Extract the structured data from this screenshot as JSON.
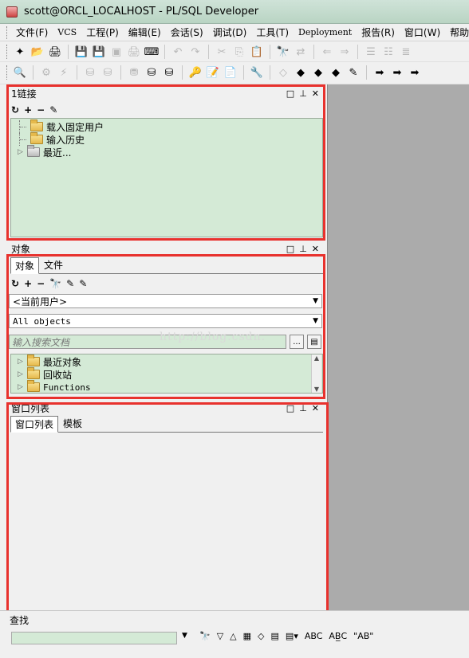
{
  "window": {
    "title": "scott@ORCL_LOCALHOST - PL/SQL Developer"
  },
  "menu": [
    {
      "label": "文件(F)",
      "latin": false
    },
    {
      "label": "VCS",
      "latin": true
    },
    {
      "label": "工程(P)",
      "latin": false
    },
    {
      "label": "编辑(E)",
      "latin": false
    },
    {
      "label": "会话(S)",
      "latin": false
    },
    {
      "label": "调试(D)",
      "latin": false
    },
    {
      "label": "工具(T)",
      "latin": false
    },
    {
      "label": "Deployment",
      "latin": true
    },
    {
      "label": "报告(R)",
      "latin": false
    },
    {
      "label": "窗口(W)",
      "latin": false
    },
    {
      "label": "帮助",
      "latin": false
    }
  ],
  "toolbar1": [
    {
      "glyph": "✦",
      "name": "new-icon",
      "disabled": false
    },
    {
      "glyph": "📂",
      "name": "open-folder-icon",
      "disabled": false
    },
    {
      "glyph": "🖨",
      "name": "print-setup-icon",
      "disabled": false
    },
    {
      "sep": true
    },
    {
      "glyph": "💾",
      "name": "save-icon",
      "disabled": true
    },
    {
      "glyph": "💾",
      "name": "save-as-icon",
      "disabled": true
    },
    {
      "glyph": "▣",
      "name": "save-all-icon",
      "disabled": true
    },
    {
      "glyph": "🖨",
      "name": "print-icon",
      "disabled": true
    },
    {
      "glyph": "⌨",
      "name": "keyboard-icon",
      "disabled": false
    },
    {
      "sep": true
    },
    {
      "glyph": "↶",
      "name": "undo-icon",
      "disabled": true
    },
    {
      "glyph": "↷",
      "name": "redo-icon",
      "disabled": true
    },
    {
      "sep": true
    },
    {
      "glyph": "✂",
      "name": "cut-icon",
      "disabled": true
    },
    {
      "glyph": "⎘",
      "name": "copy-icon",
      "disabled": true
    },
    {
      "glyph": "📋",
      "name": "paste-icon",
      "disabled": false
    },
    {
      "sep": true
    },
    {
      "glyph": "🔭",
      "name": "find-icon",
      "disabled": false
    },
    {
      "glyph": "⇄",
      "name": "replace-icon",
      "disabled": true
    },
    {
      "sep": true
    },
    {
      "glyph": "⇐",
      "name": "navigate-back-icon",
      "disabled": true
    },
    {
      "glyph": "⇒",
      "name": "navigate-forward-icon",
      "disabled": true
    },
    {
      "sep": true
    },
    {
      "glyph": "☰",
      "name": "indent-icon",
      "disabled": true
    },
    {
      "glyph": "☷",
      "name": "unindent-icon",
      "disabled": true
    },
    {
      "glyph": "≣",
      "name": "comment-icon",
      "disabled": true
    }
  ],
  "toolbar2": [
    {
      "glyph": "🔍",
      "name": "query-icon",
      "disabled": false
    },
    {
      "sep": true
    },
    {
      "glyph": "⚙",
      "name": "execute-icon",
      "disabled": true
    },
    {
      "glyph": "⚡",
      "name": "break-icon",
      "disabled": true
    },
    {
      "sep": true
    },
    {
      "glyph": "⛁",
      "name": "commit-icon",
      "disabled": true
    },
    {
      "glyph": "⛁",
      "name": "rollback-icon",
      "disabled": true
    },
    {
      "sep": true
    },
    {
      "glyph": "⛃",
      "name": "sql-window-icon",
      "disabled": true
    },
    {
      "glyph": "⛁",
      "name": "command-window-icon",
      "disabled": false
    },
    {
      "glyph": "⛁",
      "name": "test-window-icon",
      "disabled": false
    },
    {
      "sep": true
    },
    {
      "glyph": "🔑",
      "name": "login-icon",
      "disabled": false
    },
    {
      "glyph": "📝",
      "name": "report-icon",
      "disabled": false
    },
    {
      "glyph": "📄",
      "name": "explain-plan-icon",
      "disabled": false
    },
    {
      "sep": true
    },
    {
      "glyph": "🔧",
      "name": "tools-icon",
      "disabled": false
    },
    {
      "sep": true
    },
    {
      "glyph": "◇",
      "name": "eraser-icon",
      "disabled": true
    },
    {
      "glyph": "◆",
      "name": "bookmark-icon",
      "disabled": false
    },
    {
      "glyph": "◆",
      "name": "bookmark-prev-icon",
      "disabled": false
    },
    {
      "glyph": "◆",
      "name": "bookmark-next-icon",
      "disabled": false
    },
    {
      "glyph": "✎",
      "name": "edit-icon",
      "disabled": false
    },
    {
      "sep": true
    },
    {
      "glyph": "➡",
      "name": "forward-arrow-icon",
      "disabled": false
    },
    {
      "glyph": "➡",
      "name": "step-arrow-icon",
      "disabled": false
    },
    {
      "glyph": "➡",
      "name": "run-arrow-icon",
      "disabled": false
    }
  ],
  "connections": {
    "title": "1链接",
    "tools": [
      "↻",
      "+",
      "−",
      "✎"
    ],
    "items": [
      {
        "label": "载入固定用户",
        "grey": false,
        "expander": false
      },
      {
        "label": "输入历史",
        "grey": false,
        "expander": false
      },
      {
        "label": "最近...",
        "grey": true,
        "expander": true
      }
    ]
  },
  "objects": {
    "title": "对象",
    "tabs": [
      "对象",
      "文件"
    ],
    "tools": [
      "↻",
      "+",
      "−",
      "🔭",
      "✎",
      "✎"
    ],
    "user_select": "<当前用户>",
    "filter_select": "All objects",
    "search_placeholder": "输入搜索文档",
    "more_button": "...",
    "items": [
      {
        "label": "最近对象",
        "mono": false
      },
      {
        "label": "回收站",
        "mono": false
      },
      {
        "label": "Functions",
        "mono": true
      }
    ]
  },
  "window_list": {
    "title": "窗口列表",
    "tabs": [
      "窗口列表",
      "模板"
    ]
  },
  "panel_controls": [
    "□",
    "⊥",
    "✕"
  ],
  "watermark": "http://blog.csdn.",
  "find": {
    "title": "查找",
    "tools": [
      "🔭",
      "▽",
      "△",
      "▦",
      "◇",
      "▤",
      "▤▾",
      "ABC",
      "AB̲C",
      "\"AB\""
    ]
  }
}
